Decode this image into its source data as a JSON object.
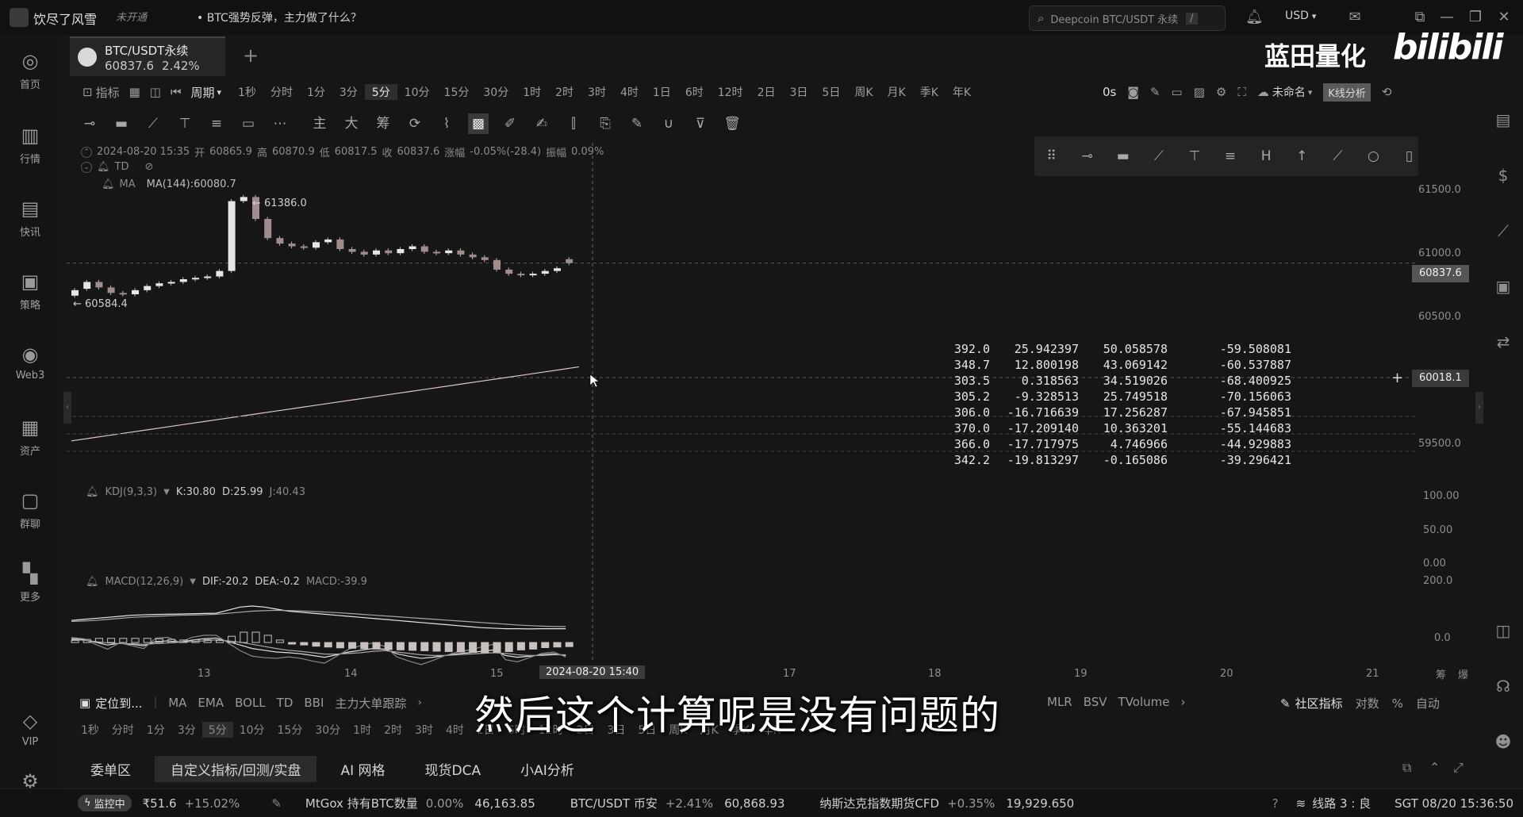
{
  "titlebar": {
    "user": "饮尽了风雪",
    "vip_badge": "未开通",
    "news": "• BTC强势反弹，主力做了什么？",
    "search_text": "Deepcoin BTC/USDT 永续",
    "search_shortcut": "/",
    "currency": "USD",
    "currency_arrow": "▾"
  },
  "watermark": {
    "cn": "蓝田量化",
    "bili": "bilibili"
  },
  "sidebar": {
    "items": [
      {
        "label": "首页",
        "icon": "home-icon"
      },
      {
        "label": "行情",
        "icon": "market-icon"
      },
      {
        "label": "快讯",
        "icon": "news-icon"
      },
      {
        "label": "策略",
        "icon": "robot-icon"
      },
      {
        "label": "Web3",
        "icon": "web3-icon"
      },
      {
        "label": "资产",
        "icon": "wallet-icon"
      },
      {
        "label": "群聊",
        "icon": "chat-icon"
      },
      {
        "label": "更多",
        "icon": "grid-icon"
      }
    ],
    "vip": "VIP"
  },
  "symbol_tab": {
    "name": "BTC/USDT永续",
    "price": "60837.6",
    "change": "2.42%"
  },
  "toolbar1": {
    "indicators": "指标",
    "period": "周期",
    "period_arrow": "▾",
    "periods": [
      "1秒",
      "分时",
      "1分",
      "3分",
      "5分",
      "10分",
      "15分",
      "30分",
      "1时",
      "2时",
      "3时",
      "4时",
      "1日",
      "6时",
      "12时",
      "2日",
      "3日",
      "5日",
      "周K",
      "月K",
      "季K",
      "年K"
    ],
    "active_period": "5分",
    "countdown": "0s",
    "layout_name": "未命名",
    "layout_arrow": "▾",
    "kline_btn": "K线分析"
  },
  "toolbar2_icons": [
    "horizontal-line-icon",
    "ruler-icon",
    "trend-line-icon",
    "text-tool-icon",
    "parallel-lines-icon",
    "rectangle-icon",
    "more-dots-icon",
    "main-chart-icon",
    "enlarge-icon",
    "chip-icon",
    "sync-icon",
    "measure-icon",
    "selection-icon",
    "pencil-icon",
    "highlighter-icon",
    "candle-icon",
    "copy-icon",
    "edit-icon",
    "magnet-icon",
    "filter-icon",
    "trash-icon"
  ],
  "toolbar2_labels": {
    "main": "主",
    "big": "大",
    "chips": "筹"
  },
  "ohlc": {
    "datetime": "2024-08-20 15:35",
    "open_label": "开",
    "open": "60865.9",
    "high_label": "高",
    "high": "60870.9",
    "low_label": "低",
    "low": "60817.5",
    "close_label": "收",
    "close": "60837.6",
    "change_label": "涨幅",
    "change": "-0.05%(-28.4)",
    "amp_label": "振幅",
    "amp": "0.09%"
  },
  "indicators": {
    "td": "TD",
    "ma_name": "MA",
    "ma_value": "MA(144):60080.7",
    "high_marker": "← 61386.0",
    "low_marker": "← 60584.4",
    "kdj": "KDJ(9,3,3)",
    "kdj_k": "K:30.80",
    "kdj_d": "D:25.99",
    "kdj_j": "J:40.43",
    "macd": "MACD(12,26,9)",
    "macd_dif": "DIF:-20.2",
    "macd_dea": "DEA:-0.2",
    "macd_val": "MACD:-39.9"
  },
  "price_axis": {
    "labels": [
      "61500.0",
      "61000.0",
      "60500.0",
      "59500.0"
    ],
    "current_tag": "60837.6",
    "cursor_tag": "60018.1",
    "kdj_labels": [
      "100.00",
      "50.00",
      "0.00"
    ],
    "macd_labels": [
      "200.0",
      "0.0"
    ]
  },
  "time_axis": {
    "labels": [
      "13",
      "14",
      "15",
      "17",
      "18",
      "19",
      "20",
      "21"
    ],
    "cursor_time": "2024-08-20 15:40",
    "extra": [
      "筹",
      "爆"
    ]
  },
  "data_table": {
    "rows": [
      [
        "392.0",
        "25.942397",
        "50.058578",
        "-59.508081"
      ],
      [
        "348.7",
        "12.800198",
        "43.069142",
        "-60.537887"
      ],
      [
        "303.5",
        "0.318563",
        "34.519026",
        "-68.400925"
      ],
      [
        "305.2",
        "-9.328513",
        "25.749518",
        "-70.156063"
      ],
      [
        "306.0",
        "-16.716639",
        "17.256287",
        "-67.945851"
      ],
      [
        "370.0",
        "-17.209140",
        "10.363201",
        "-55.144683"
      ],
      [
        "366.0",
        "-17.717975",
        "4.746966",
        "-44.929883"
      ],
      [
        "342.2",
        "-19.813297",
        "-0.165086",
        "-39.296421"
      ]
    ]
  },
  "indicator_bar": {
    "locate": "定位到...",
    "items": [
      "MA",
      "EMA",
      "BOLL",
      "TD",
      "BBI",
      "主力大单跟踪"
    ],
    "right_items": [
      "MLR",
      "BSV",
      "TVolume"
    ],
    "community": "社区指标",
    "log": "对数",
    "percent": "%",
    "auto": "自动"
  },
  "period_bar": {
    "periods": [
      "1秒",
      "分时",
      "1分",
      "3分",
      "5分",
      "10分",
      "15分",
      "30分",
      "1时",
      "2时",
      "3时",
      "4时",
      "1日",
      "6时",
      "12时",
      "2日",
      "3日",
      "5日",
      "周K",
      "月K",
      "季K",
      "年K"
    ],
    "active": "5分"
  },
  "subtitle": "然后这个计算呢是没有问题的",
  "bottom_tabs": [
    "委单区",
    "自定义指标/回测/实盘",
    "AI 网格",
    "现货DCA",
    "小AI分析"
  ],
  "bottom_active": "自定义指标/回测/实盘",
  "status_bar": {
    "monitor": "监控中",
    "fund": "₹51.6",
    "fund_change": "+15.02%",
    "t1_name": "MtGox 持有BTC数量",
    "t1_change": "0.00%",
    "t1_value": "46,163.85",
    "t2_name": "BTC/USDT 币安",
    "t2_change": "+2.41%",
    "t2_value": "60,868.93",
    "t3_name": "纳斯达克指数期货CFD",
    "t3_change": "+0.35%",
    "t3_value": "19,929.650",
    "line": "线路 3 : 良",
    "clock": "SGT 08/20 15:36:50"
  },
  "chart_data": {
    "type": "candlestick",
    "candles_close": [
      60640,
      60700,
      60660,
      60620,
      60610,
      60640,
      60670,
      60690,
      60700,
      60720,
      60730,
      60740,
      60780,
      61290,
      61320,
      61160,
      61020,
      60980,
      60960,
      60950,
      60990,
      61010,
      60940,
      60920,
      60900,
      60930,
      60910,
      60940,
      60960,
      60920,
      60910,
      60930,
      60900,
      60880,
      60860,
      60790,
      60760,
      60750,
      60760,
      60780,
      60800,
      60837.6
    ],
    "candles_open": [
      60600,
      60650,
      60700,
      60660,
      60620,
      60610,
      60640,
      60670,
      60690,
      60700,
      60720,
      60730,
      60740,
      60780,
      61290,
      61320,
      61160,
      61020,
      60980,
      60960,
      60950,
      60990,
      61010,
      60940,
      60920,
      60900,
      60930,
      60910,
      60940,
      60960,
      60920,
      60910,
      60930,
      60900,
      60880,
      60860,
      60790,
      60760,
      60750,
      60760,
      60780,
      60865.9
    ],
    "ma144": [
      59540,
      59560,
      59580,
      59600,
      59620,
      59640,
      59660,
      59680,
      59700,
      59720,
      59740,
      59760,
      59780,
      59800,
      59820,
      59840,
      59860,
      59880,
      59900,
      59920,
      59940,
      59960,
      59980,
      60000,
      60020,
      60040,
      60060,
      60080.7
    ],
    "ylim": [
      59400,
      61600
    ],
    "kdj_k": [
      88,
      86,
      78,
      70,
      75,
      72,
      68,
      80,
      82,
      78,
      84,
      88,
      90,
      80,
      70,
      60,
      55,
      50,
      48,
      45,
      40,
      35,
      42,
      50,
      55,
      60,
      58,
      45,
      38,
      32,
      35,
      40,
      45,
      48,
      52,
      56,
      40,
      35,
      38,
      42,
      45,
      40
    ],
    "kdj_d": [
      85,
      84,
      80,
      76,
      74,
      74,
      72,
      74,
      76,
      78,
      80,
      82,
      85,
      82,
      78,
      72,
      66,
      60,
      55,
      52,
      48,
      44,
      44,
      46,
      48,
      52,
      54,
      50,
      46,
      42,
      40,
      40,
      42,
      44,
      46,
      48,
      46,
      42,
      40,
      40,
      42,
      42
    ],
    "kdj_j": [
      92,
      88,
      72,
      58,
      76,
      68,
      60,
      90,
      92,
      78,
      92,
      98,
      98,
      76,
      54,
      38,
      34,
      32,
      36,
      32,
      24,
      18,
      38,
      58,
      68,
      76,
      66,
      36,
      24,
      14,
      26,
      40,
      50,
      56,
      64,
      72,
      28,
      22,
      34,
      46,
      50,
      36
    ],
    "macd_dif": [
      60,
      70,
      80,
      90,
      100,
      110,
      115,
      118,
      120,
      122,
      125,
      128,
      130,
      160,
      190,
      200,
      190,
      170,
      150,
      140,
      130,
      120,
      110,
      100,
      90,
      80,
      70,
      60,
      50,
      40,
      30,
      20,
      10,
      0,
      -10,
      -15,
      -20,
      -20,
      -22,
      -20,
      -20,
      -20.2
    ],
    "macd_dea": [
      50,
      55,
      60,
      70,
      80,
      90,
      95,
      100,
      105,
      110,
      112,
      115,
      120,
      130,
      140,
      150,
      155,
      158,
      156,
      152,
      148,
      142,
      136,
      128,
      120,
      112,
      104,
      96,
      88,
      80,
      72,
      64,
      56,
      48,
      40,
      32,
      24,
      16,
      10,
      5,
      2,
      -0.2
    ],
    "macd_hist": [
      20,
      30,
      40,
      40,
      40,
      40,
      40,
      36,
      30,
      24,
      26,
      26,
      20,
      60,
      100,
      100,
      70,
      24,
      -12,
      -24,
      -36,
      -44,
      -52,
      -56,
      -60,
      -64,
      -68,
      -72,
      -76,
      -80,
      -84,
      -88,
      -92,
      -96,
      -100,
      -94,
      -88,
      -72,
      -64,
      -50,
      -44,
      -39.9
    ]
  }
}
